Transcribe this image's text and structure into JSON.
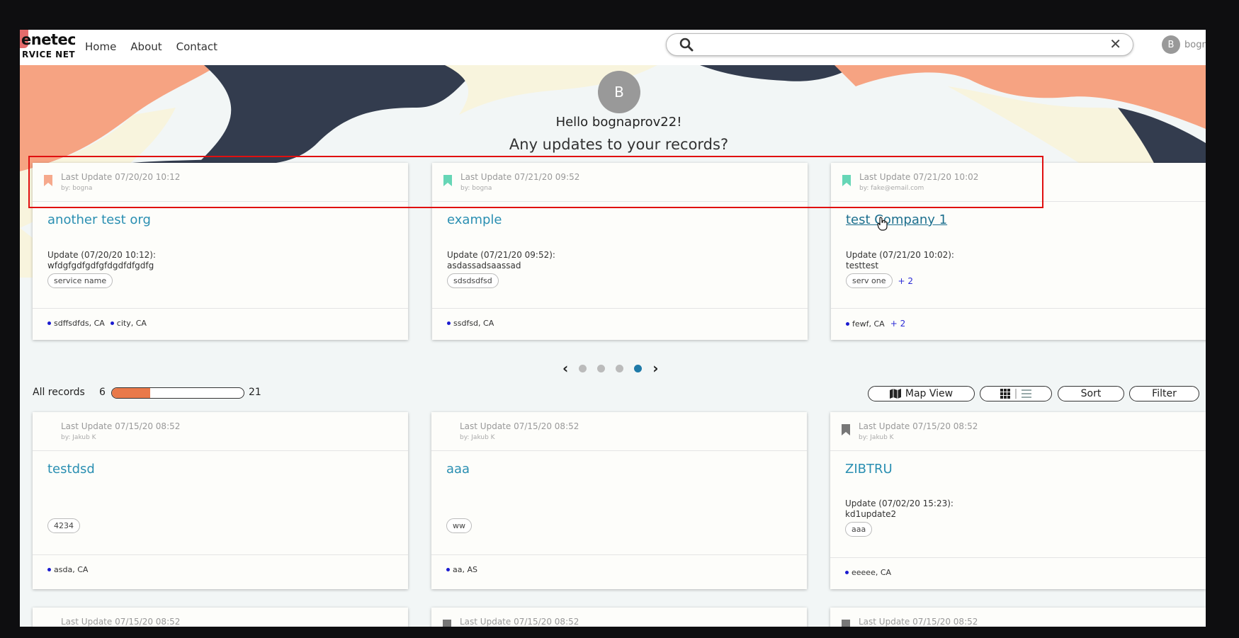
{
  "header": {
    "logo_line1": "enetech",
    "logo_line2": "RVICE NET",
    "nav": [
      "Home",
      "About",
      "Contact"
    ],
    "search_placeholder": "",
    "user_initial": "B",
    "user_name": "bogn"
  },
  "hero": {
    "avatar_initial": "B",
    "greeting": "Hello bognaprov22!",
    "subtitle": "Any updates to your records?"
  },
  "recent_cards": [
    {
      "last_update": "Last Update 07/20/20 10:12",
      "by": "by: bogna",
      "bookmark_color": "#f6a98c",
      "title": "another test org",
      "update_line1": "Update (07/20/20 10:12):",
      "update_line2": "wfdgfgdfgdfgfdgdfdfgdfg",
      "tags": [
        "service name"
      ],
      "tags_more": "",
      "locations": [
        "sdffsdfds, CA",
        "city, CA"
      ],
      "locations_more": ""
    },
    {
      "last_update": "Last Update 07/21/20 09:52",
      "by": "by: bogna",
      "bookmark_color": "#66d6b6",
      "title": "example",
      "update_line1": "Update (07/21/20 09:52):",
      "update_line2": "asdassadsaassad",
      "tags": [
        "sdsdsdfsd"
      ],
      "tags_more": "",
      "locations": [
        "ssdfsd, CA"
      ],
      "locations_more": ""
    },
    {
      "last_update": "Last Update 07/21/20 10:02",
      "by": "by: fake@email.com",
      "bookmark_color": "#66d6b6",
      "title": "test Company 1",
      "update_line1": "Update (07/21/20 10:02):",
      "update_line2": "testtest",
      "tags": [
        "serv one"
      ],
      "tags_more": "+ 2",
      "locations": [
        "fewf, CA"
      ],
      "locations_more": "+ 2"
    }
  ],
  "pager": {
    "pages": 4,
    "active_index": 3
  },
  "records_bar": {
    "label": "All records",
    "current": "6",
    "total": "21",
    "progress_fraction": 0.29,
    "map_view": "Map View",
    "sort": "Sort",
    "filter": "Filter"
  },
  "all_records": [
    {
      "last_update": "Last Update 07/15/20 08:52",
      "by": "by: Jakub K",
      "bookmark_color": "",
      "title": "testdsd",
      "update_line1": "",
      "update_line2": "",
      "tags": [
        "4234"
      ],
      "locations": [
        "asda, CA"
      ]
    },
    {
      "last_update": "Last Update 07/15/20 08:52",
      "by": "by: Jakub K",
      "bookmark_color": "",
      "title": "aaa",
      "update_line1": "",
      "update_line2": "",
      "tags": [
        "ww"
      ],
      "locations": [
        "aa, AS"
      ]
    },
    {
      "last_update": "Last Update 07/15/20 08:52",
      "by": "by: Jakub K",
      "bookmark_color": "#777777",
      "title": "ZIBTRU",
      "update_line1": "Update (07/02/20 15:23):",
      "update_line2": "kd1update2",
      "tags": [
        "aaa"
      ],
      "locations": [
        "eeeee, CA"
      ]
    }
  ],
  "partial_row": [
    {
      "last_update": "Last Update 07/15/20 08:52",
      "bookmark_color": ""
    },
    {
      "last_update": "Last Update 07/15/20 08:52",
      "bookmark_color": "#777777"
    },
    {
      "last_update": "Last Update 07/15/20 08:52",
      "bookmark_color": "#777777"
    }
  ]
}
